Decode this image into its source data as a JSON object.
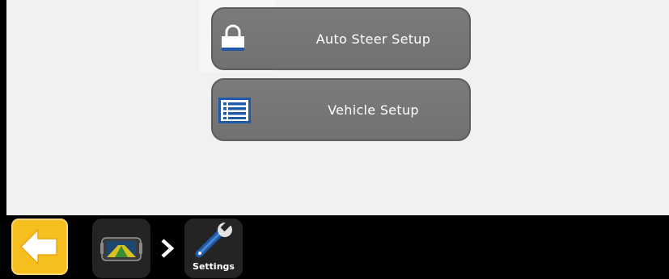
{
  "menu": {
    "items": [
      {
        "label": "Auto Steer Setup",
        "icon": "lock-icon"
      },
      {
        "label": "Vehicle Setup",
        "icon": "list-icon"
      }
    ]
  },
  "nav": {
    "back_icon": "back-arrow-icon",
    "breadcrumb": [
      {
        "icon": "display-icon",
        "label": ""
      },
      {
        "icon": "wrench-icon",
        "label": "Settings"
      }
    ],
    "separator_icon": "chevron-right-icon"
  },
  "colors": {
    "content_bg": "#f1f1f1",
    "button_bg": "#777777",
    "bar_bg": "#000000",
    "back_accent": "#f6bf1d"
  }
}
